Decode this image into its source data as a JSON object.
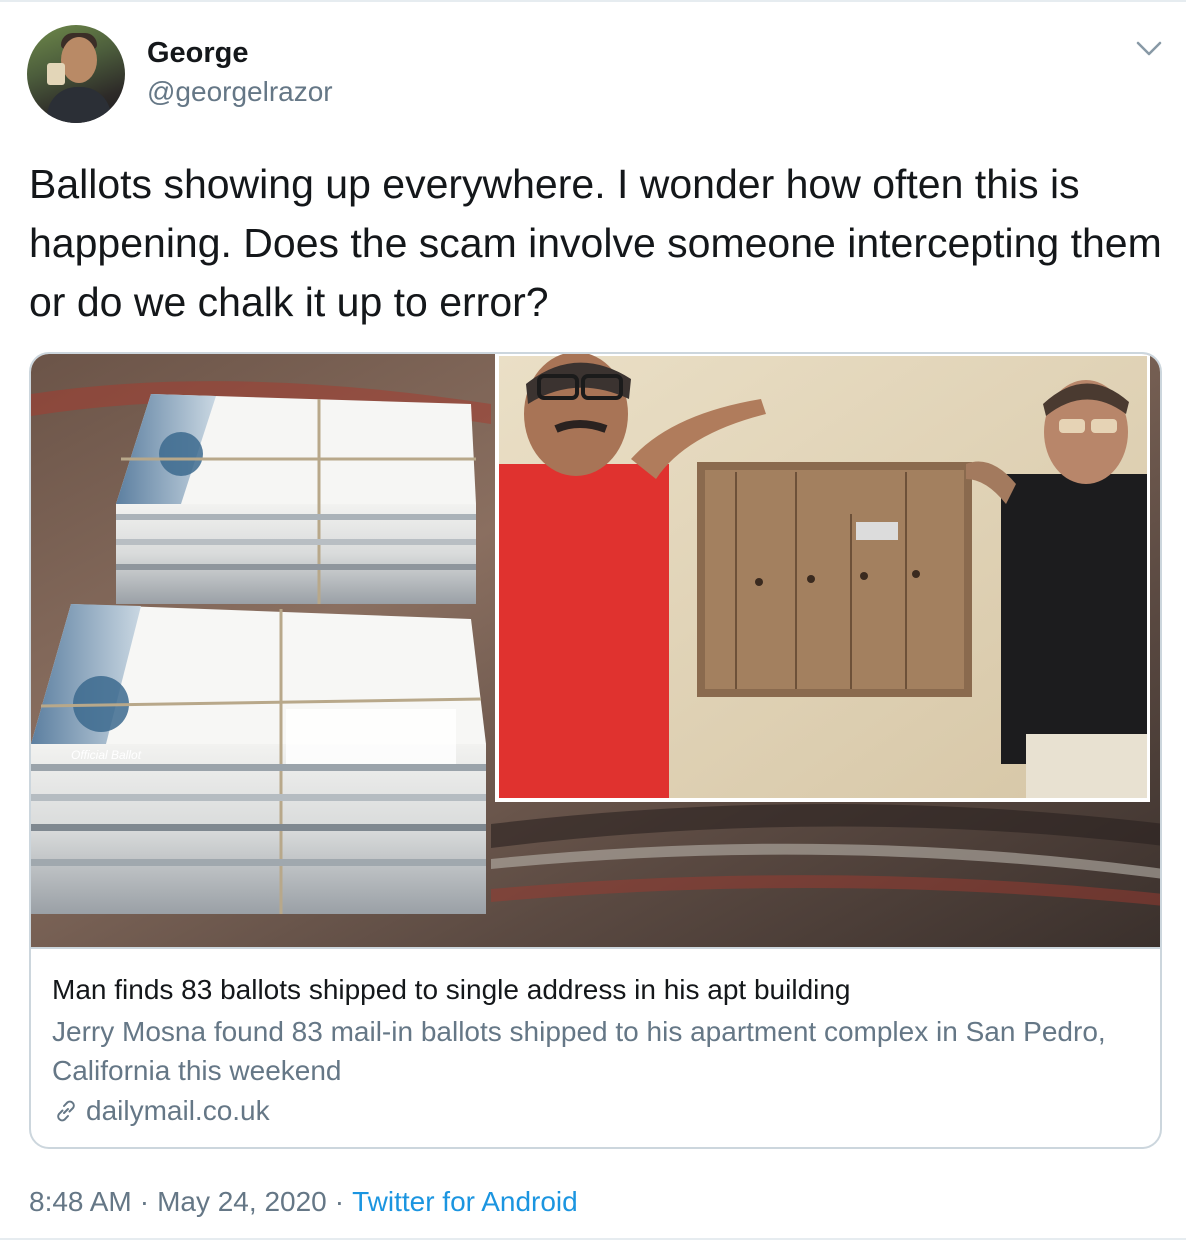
{
  "author": {
    "name": "George",
    "handle": "@georgelrazor"
  },
  "tweet": {
    "text": "Ballots showing up everywhere. I wonder how often this is happening. Does the scam involve someone intercepting them or do we chalk it up to error?"
  },
  "card": {
    "title": "Man finds 83 ballots shipped to single address in his apt building",
    "description": "Jerry Mosna found 83 mail-in ballots shipped to his apartment complex in San Pedro, California this weekend",
    "domain": "dailymail.co.uk",
    "image_alt_icon": "news-photo",
    "envelope_text": "Official Ballot"
  },
  "meta": {
    "time": "8:48 AM",
    "separator": "·",
    "date": "May 24, 2020",
    "source": "Twitter for Android"
  },
  "colors": {
    "text_primary": "#14171a",
    "text_secondary": "#657786",
    "link": "#1b95e0",
    "border": "#ccd6dd"
  },
  "icons": [
    "chevron-down-icon",
    "link-icon"
  ]
}
